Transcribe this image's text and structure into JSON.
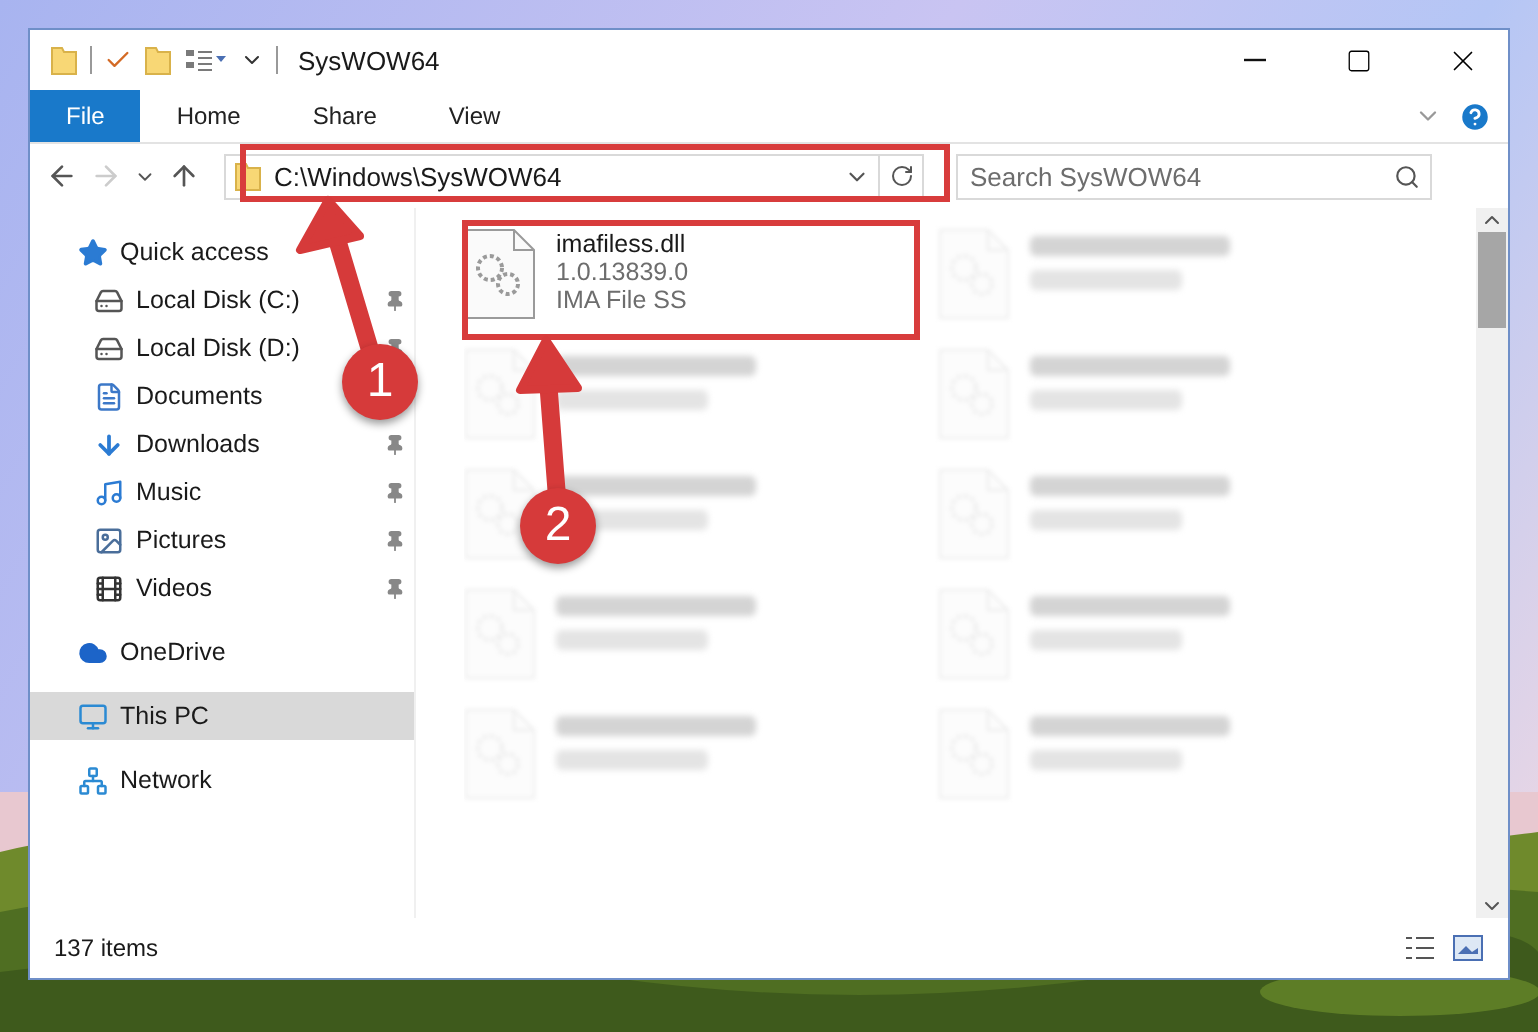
{
  "window": {
    "title": "SysWOW64"
  },
  "ribbon": {
    "tabs": [
      {
        "label": "File",
        "selected": true
      },
      {
        "label": "Home",
        "selected": false
      },
      {
        "label": "Share",
        "selected": false
      },
      {
        "label": "View",
        "selected": false
      }
    ]
  },
  "address_bar": {
    "path": "C:\\Windows\\SysWOW64"
  },
  "search": {
    "placeholder": "Search SysWOW64"
  },
  "sidebar": {
    "items": [
      {
        "label": "Quick access",
        "selected": false,
        "pinned": false,
        "children": [
          {
            "label": "Local Disk (C:)",
            "selected": false,
            "pinned": true
          },
          {
            "label": "Local Disk (D:)",
            "selected": false,
            "pinned": true
          },
          {
            "label": "Documents",
            "selected": false,
            "pinned": false
          },
          {
            "label": "Downloads",
            "selected": false,
            "pinned": true
          },
          {
            "label": "Music",
            "selected": false,
            "pinned": true
          },
          {
            "label": "Pictures",
            "selected": false,
            "pinned": true
          },
          {
            "label": "Videos",
            "selected": false,
            "pinned": true
          }
        ]
      },
      {
        "label": "OneDrive",
        "selected": false,
        "pinned": false
      },
      {
        "label": "This PC",
        "selected": true,
        "pinned": false
      },
      {
        "label": "Network",
        "selected": false,
        "pinned": false
      }
    ]
  },
  "files": [
    {
      "kind": "file",
      "name": "imafiless.dll",
      "lines": [
        "1.0.13839.0",
        "IMA File SS"
      ]
    },
    {
      "kind": "blurred"
    },
    {
      "kind": "blurred"
    },
    {
      "kind": "blurred"
    },
    {
      "kind": "blurred"
    },
    {
      "kind": "blurred"
    },
    {
      "kind": "blurred"
    },
    {
      "kind": "blurred"
    },
    {
      "kind": "blurred"
    },
    {
      "kind": "blurred"
    }
  ],
  "status_bar": {
    "count": "137 items"
  },
  "annotations": [
    {
      "number": "1"
    },
    {
      "number": "2"
    }
  ]
}
